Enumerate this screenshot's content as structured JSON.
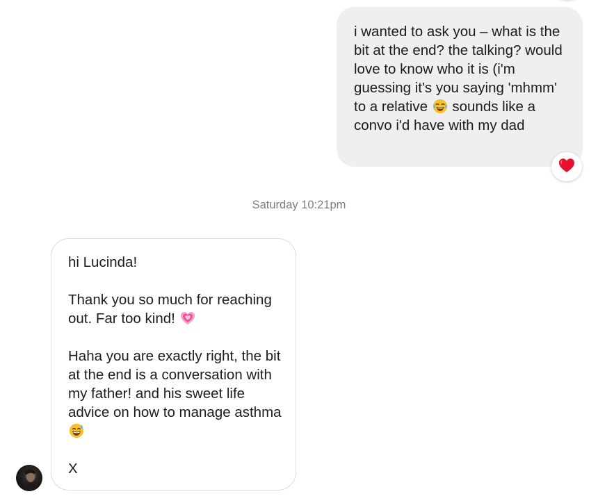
{
  "conversation": {
    "outgoing": {
      "text_before_emoji": "i wanted to ask you – what is the bit at the end? the talking? would love to know who it is (i'm guessing it's you saying 'mhmm' to a relative ",
      "emoji": "face-with-tears-of-joy",
      "text_after_emoji": " sounds like a convo i'd have with my dad",
      "reaction": "red-heart"
    },
    "timestamp": "Saturday 10:21pm",
    "incoming": {
      "greeting": "hi Lucinda!",
      "para2_text": "Thank you so much for reaching out. Far too kind! ",
      "para2_emoji": "growing-heart",
      "para3_text": "Haha you are exactly right, the bit at the end is a conversation with my father! and his sweet life advice on how to manage asthma ",
      "para3_emoji": "grinning-face-with-sweat",
      "signoff": "X"
    },
    "sender_avatar": "profile-photo"
  },
  "colors": {
    "outgoing_bubble": "#efefef",
    "incoming_border": "#dcdcdc",
    "timestamp_text": "#7d7d7d",
    "heart": "#e8112d"
  }
}
